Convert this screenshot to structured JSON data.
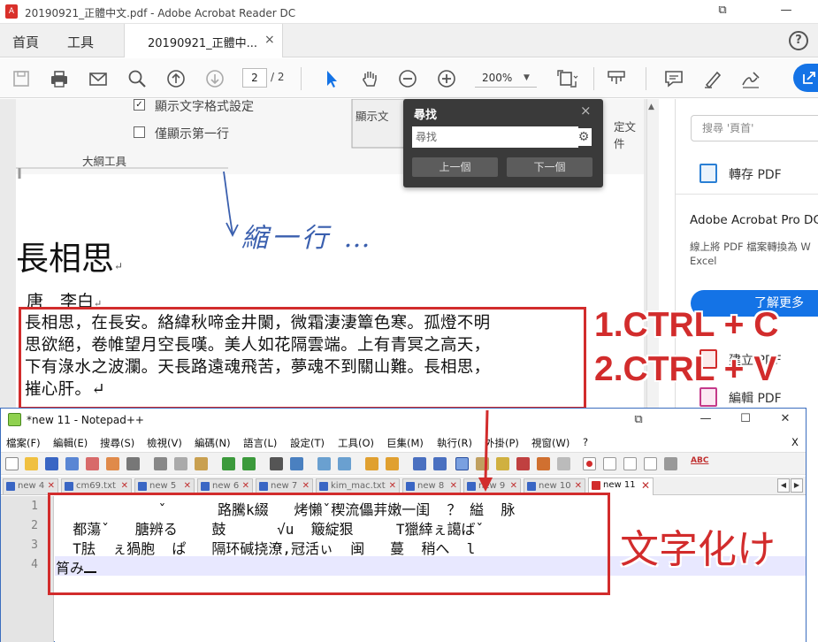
{
  "acrobat": {
    "window_title": "20190921_正體中文.pdf - Adobe Acrobat Reader DC",
    "title_icon": "A",
    "nav": {
      "home": "首頁",
      "tools": "工具"
    },
    "tab_label": "20190921_正體中...",
    "tab_close": "×",
    "help": "?",
    "window_controls": {
      "restore": "⧉",
      "minimize": "—"
    },
    "toolbar": {
      "page_current": "2",
      "page_total": "/ 2",
      "zoom": "200%",
      "icons": [
        "save-icon",
        "print-icon",
        "email-icon",
        "search-zoom-icon",
        "page-up-icon",
        "page-down-icon",
        "select-cursor-icon",
        "hand-tool-icon",
        "zoom-out-icon",
        "zoom-in-icon",
        "fit-page-icon",
        "scroll-mode-icon",
        "comment-icon",
        "highlight-pen-icon",
        "sign-icon",
        "share-icon"
      ]
    },
    "find_panel": {
      "title": "尋找",
      "close": "×",
      "placeholder": "尋找",
      "prev": "上一個",
      "next": "下一個",
      "gear": "⚙"
    },
    "right_pane": {
      "search_placeholder": "搜尋 '頁首'",
      "export_pdf": "轉存 PDF",
      "ad_title": "Adobe Acrobat Pro DC",
      "ad_text_1": "線上將 PDF 檔案轉換為 W",
      "ad_text_2": "Excel",
      "learn_more": "了解更多",
      "create_pdf": "建立 PDF",
      "edit_pdf": "編輯 PDF"
    },
    "scan": {
      "check1": "顯示文字格式設定",
      "check2": "僅顯示第一行",
      "outline_tools": "大綱工具",
      "partial_button": "顯示文",
      "partial_right": "定文件",
      "handwriting": "縮一行 …"
    },
    "poem": {
      "title": "長相思",
      "title_mark": "↵",
      "author": "唐　李白",
      "author_mark": "↵",
      "lines": [
        "長相思，在長安。絡緯秋啼金井闌，微霜淒淒簟色寒。孤燈不明",
        "思欲絕，卷帷望月空長嘆。美人如花隔雲端。上有青冥之高天，",
        "下有淥水之波瀾。天長路遠魂飛苦，夢魂不到關山難。長相思，",
        "摧心肝。↵"
      ]
    }
  },
  "annotations": {
    "step1": "1.CTRL + C",
    "step2": "2.CTRL + V",
    "mojibake_label": "文字化け"
  },
  "notepad": {
    "window_title": "*new 11 - Notepad++",
    "window_controls": {
      "restore": "⧉",
      "minimize": "—",
      "maximize": "☐",
      "close": "✕"
    },
    "menu_close": "X",
    "menu": [
      "檔案(F)",
      "編輯(E)",
      "搜尋(S)",
      "檢視(V)",
      "編碼(N)",
      "語言(L)",
      "設定(T)",
      "工具(O)",
      "巨集(M)",
      "執行(R)",
      "外掛(P)",
      "視窗(W)",
      "?"
    ],
    "tabs": [
      "new 4",
      "cm69.txt",
      "new 5",
      "new 6",
      "new 7",
      "kim_mac.txt",
      "new 8",
      "new 9",
      "new 10",
      "new 11"
    ],
    "tab_close": "✕",
    "active_tab": "new 11",
    "line_numbers": [
      "1",
      "2",
      "3",
      "4"
    ],
    "lines": [
      "            ˇ      路騰k綴   烤懶ˇ稧流儡茾嫩一闺  ？ 縊  脉",
      "  都蕩ˇ   膅辨る    鼓      √u  簸綻狠     T獵緈ぇ譪ばˇ",
      "  T胠  ぇ猧胞  ぱ   隔环碱挠潦,冠活ぃ  闽   蔓  稍へ  l",
      "筲み"
    ]
  }
}
